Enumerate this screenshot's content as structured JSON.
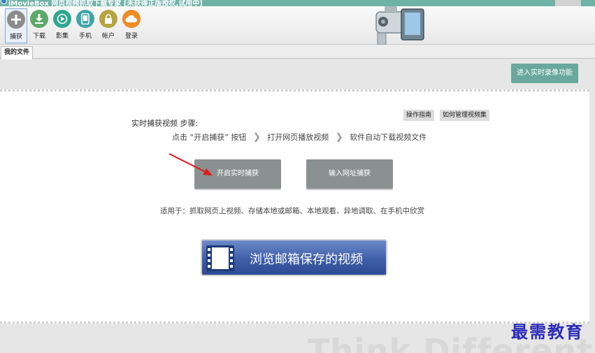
{
  "titlebar": {
    "title": "iMovieBox 网页视频抓取下载专家 [未获得正版授权,试用中]"
  },
  "toolbar": {
    "items": [
      {
        "label": "捕获",
        "icon": "plus-icon"
      },
      {
        "label": "下载",
        "icon": "download-icon"
      },
      {
        "label": "影集",
        "icon": "play-icon"
      },
      {
        "label": "手机",
        "icon": "phone-icon"
      },
      {
        "label": "帐户",
        "icon": "lock-icon"
      },
      {
        "label": "登录",
        "icon": "cloud-icon"
      }
    ]
  },
  "tabs": [
    {
      "label": "我的文件"
    }
  ],
  "main": {
    "enter_realtime_label": "进入实时录像功能",
    "steps_title": "实时捕获视频 步骤:",
    "guide_label": "操作指南",
    "manage_label": "如何管理视频集",
    "steps": [
      "点击 “开启捕获” 按钮",
      "打开网页播放视频",
      "软件自动下载视频文件"
    ],
    "start_capture_label": "开启实时捕获",
    "input_url_label": "输入网址捕获",
    "usage_text": "适用于：抓取网页上视频、存储本地或邮箱、本地观看、异地调取、在手机中欣赏",
    "banner_label": "浏览邮箱保存的视频",
    "bg_text": "Think Different"
  },
  "watermark": "最需教育",
  "colors": {
    "accent": "#6aa89d",
    "button_gray": "#8b9191",
    "banner_blue": "#3e5ea9",
    "arrow_red": "#e01b1b"
  }
}
